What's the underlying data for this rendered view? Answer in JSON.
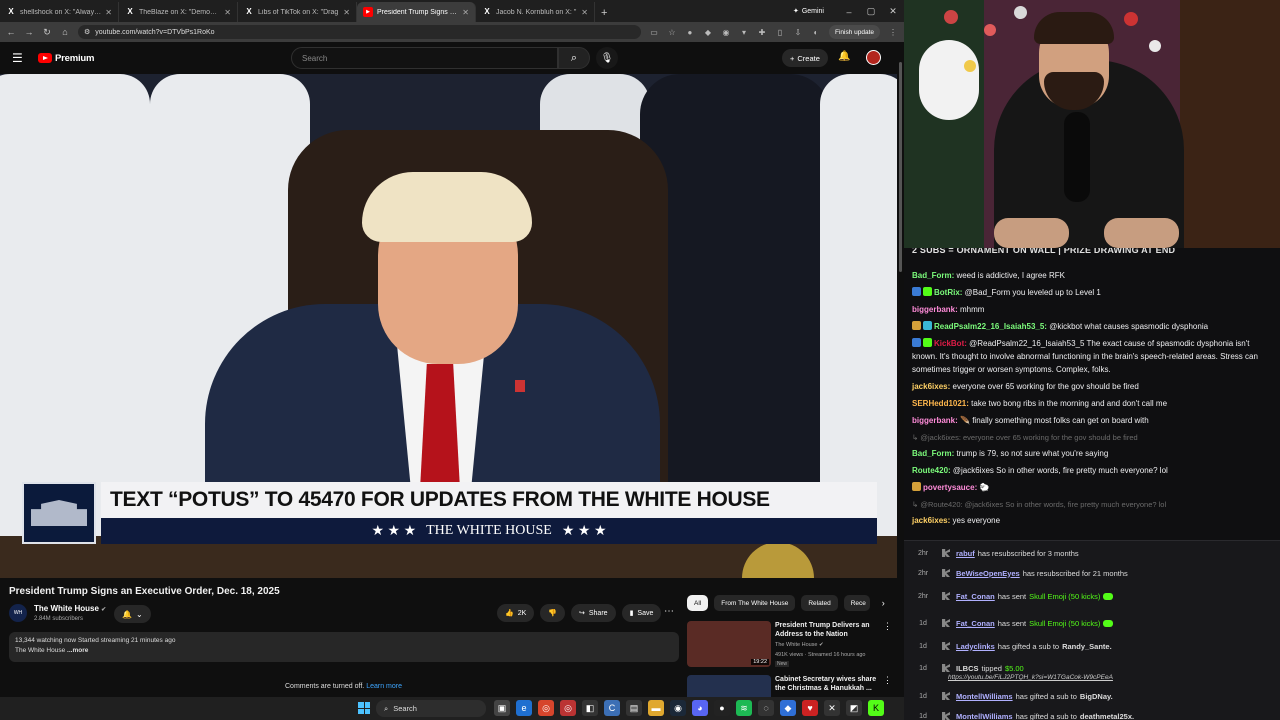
{
  "browser": {
    "tabs": [
      {
        "favicon": "x-icon",
        "title": "shellshock on X: \"Always th",
        "active": false
      },
      {
        "favicon": "x-icon",
        "title": "TheBlaze on X: \"Democrat",
        "active": false
      },
      {
        "favicon": "x-icon",
        "title": "Libs of TikTok on X: \"Drag",
        "active": false
      },
      {
        "favicon": "youtube-icon",
        "title": "President Trump Signs an E",
        "active": true
      },
      {
        "favicon": "x-icon",
        "title": "Jacob N. Kornbluh on X: \"",
        "active": false
      }
    ],
    "gemini_label": "Gemini",
    "url": "youtube.com/watch?v=DTVbPs1RoKo",
    "finish_update_label": "Finish update"
  },
  "youtube": {
    "brand": "Premium",
    "search_placeholder": "Search",
    "create_label": "Create",
    "video": {
      "lower_third_headline": "TEXT “POTUS” TO 45470 FOR UPDATES FROM THE WHITE HOUSE",
      "lower_third_sub": "THE WHITE HOUSE",
      "stars_left": "★ ★ ★",
      "stars_right": "★ ★ ★"
    },
    "title": "President Trump Signs an Executive Order, Dec. 18, 2025",
    "channel": {
      "name": "The White House",
      "verified_mark": "✔",
      "subscribers": "2.84M subscribers"
    },
    "actions": {
      "likes": "2K",
      "share": "Share",
      "save": "Save"
    },
    "description": {
      "line1": "13,344 watching now  Started streaming 21 minutes ago",
      "line2_text": "The White House ",
      "line2_more": "...more"
    },
    "comments_off": "Comments are turned off.",
    "learn_more": "Learn more",
    "chips": [
      "All",
      "From The White House",
      "Related",
      "Rece"
    ],
    "recommendations": [
      {
        "title": "President Trump Delivers an Address to the Nation",
        "channel": "The White House ✔",
        "meta": "491K views · Streamed 16 hours ago",
        "badge": "New",
        "duration": "19:22"
      },
      {
        "title": "Cabinet Secretary wives share the Christmas & Hanukkah ..."
      }
    ]
  },
  "stream": {
    "banner": "2 SUBS = ORNAMENT ON WALL | PRIZE DRAWING AT END",
    "chat": [
      {
        "user": "Bad_Form:",
        "color": "#7cfc7c",
        "text": " weed is addictive, I agree RFK",
        "badges": []
      },
      {
        "user": "BotRix:",
        "color": "#7cfc7c",
        "text": " @Bad_Form you leveled up to Level 1",
        "badges": [
          "#3a7bd5",
          "#53fc18"
        ]
      },
      {
        "user": "biggerbank:",
        "color": "#ff8cd9",
        "text": " mhmm",
        "badges": []
      },
      {
        "user": "ReadPsalm22_16_Isaiah53_5:",
        "color": "#7cfc7c",
        "text": " @kickbot what causes spasmodic dysphonia",
        "badges": [
          "#d4a03a",
          "#3ab8d5"
        ]
      },
      {
        "user": "KickBot:",
        "color": "#e11d48",
        "text": " @ReadPsalm22_16_Isaiah53_5 The exact cause of spasmodic dysphonia isn't known. It's thought to involve abnormal functioning in the brain's speech-related areas. Stress can sometimes trigger or worsen symptoms. Complex, folks.",
        "badges": [
          "#3a7bd5",
          "#53fc18"
        ]
      },
      {
        "user": "jack6ixes:",
        "color": "#ffd166",
        "text": " everyone over 65 working for the gov should be fired",
        "badges": []
      },
      {
        "user": "SERHedd1021:",
        "color": "#ffb74d",
        "text": " take two bong ribs in the morning and and don't call me",
        "badges": []
      },
      {
        "user": "biggerbank:",
        "color": "#ff8cd9",
        "text": " 🪶  finally something most folks can get on board with",
        "badges": []
      },
      {
        "reply": "↳ @jack6ixes: everyone over 65 working for the gov should be fired"
      },
      {
        "user": "Bad_Form:",
        "color": "#7cfc7c",
        "text": " trump is 79, so not sure what you're saying",
        "badges": []
      },
      {
        "user": "Route420:",
        "color": "#7cfc7c",
        "text": " @jack6ixes So in other words, fire pretty much everyone? lol",
        "badges": []
      },
      {
        "user": "povertysauce:",
        "color": "#ff8cd9",
        "text": " 🐑",
        "badges": [
          "#d4a03a"
        ]
      },
      {
        "reply": "↳ @Route420: @jack6ixes So in other words, fire pretty much everyone? lol"
      },
      {
        "user": "jack6ixes:",
        "color": "#ffd166",
        "text": " yes everyone",
        "badges": []
      }
    ],
    "events": [
      {
        "age": "2hr",
        "name": "rabuf",
        "text": "has resubscribed for 3 months"
      },
      {
        "age": "2hr",
        "name": "BeWiseOpenEyes",
        "text": "has resubscribed for 21 months"
      },
      {
        "age": "2hr",
        "name": "Fat_Conan",
        "text": "has sent",
        "green": "Skull Emoji (50 kicks)",
        "gem": true
      },
      {
        "age": "1d",
        "name": "Fat_Conan",
        "text": "has sent",
        "green": "Skull Emoji (50 kicks)",
        "gem": true
      },
      {
        "age": "1d",
        "name": "Ladyclinks",
        "text": "has gifted a sub to",
        "bold": "Randy_Sante."
      },
      {
        "age": "1d",
        "name": "ILBCS",
        "text": "tipped",
        "green": "$5.00",
        "plain": true
      },
      {
        "age": "1d",
        "name": "MontellWilliams",
        "text": "has gifted a sub to",
        "bold": "BigDNay."
      },
      {
        "age": "1d",
        "name": "MontellWilliams",
        "text": "has gifted a sub to",
        "bold": "deathmetal25x."
      }
    ],
    "tip_link": "https://youtu.be/FiLJ2PTQH_k?si=W1TGaCok-W9cPEeA"
  },
  "taskbar": {
    "search_label": "Search"
  }
}
